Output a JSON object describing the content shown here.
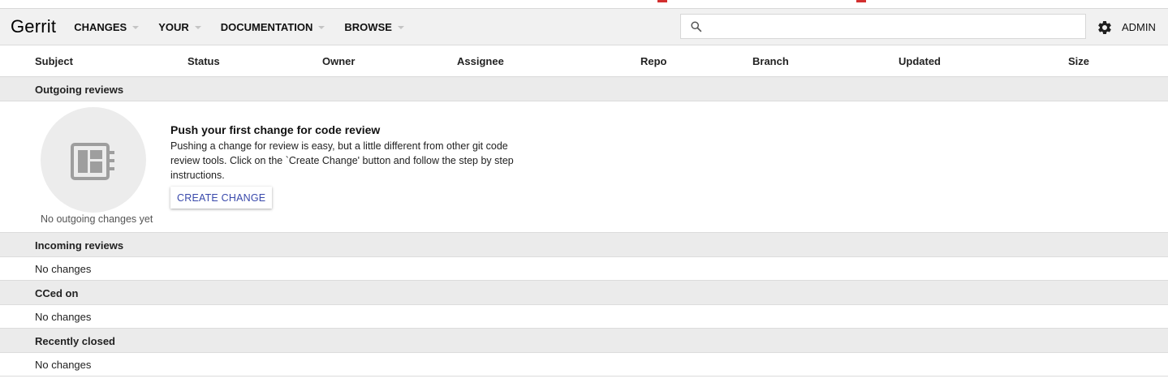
{
  "header": {
    "brand": "Gerrit",
    "nav": [
      {
        "label": "CHANGES"
      },
      {
        "label": "YOUR"
      },
      {
        "label": "DOCUMENTATION"
      },
      {
        "label": "BROWSE"
      }
    ],
    "search": {
      "placeholder": "",
      "value": ""
    },
    "user_label": "ADMIN"
  },
  "columns": [
    "Subject",
    "Status",
    "Owner",
    "Assignee",
    "Repo",
    "Branch",
    "Updated",
    "Size"
  ],
  "sections": {
    "outgoing": {
      "title": "Outgoing reviews",
      "empty_caption": "No outgoing changes yet",
      "empty_title": "Push your first change for code review",
      "empty_description": "Pushing a change for review is easy, but a little different from other git code review tools. Click on the `Create Change' button and follow the step by step instructions.",
      "button_label": "CREATE CHANGE"
    },
    "incoming": {
      "title": "Incoming reviews",
      "empty_text": "No changes"
    },
    "cced": {
      "title": "CCed on",
      "empty_text": "No changes"
    },
    "recent": {
      "title": "Recently closed",
      "empty_text": "No changes"
    }
  },
  "colors": {
    "header_bg": "#f1f1f1",
    "section_bg": "#ebebeb",
    "link_blue": "#3949ab",
    "strip_mark": "#d32f2f"
  },
  "icons": {
    "search": "search-icon",
    "settings": "gear-icon",
    "dashboard": "dashboard-icon"
  }
}
